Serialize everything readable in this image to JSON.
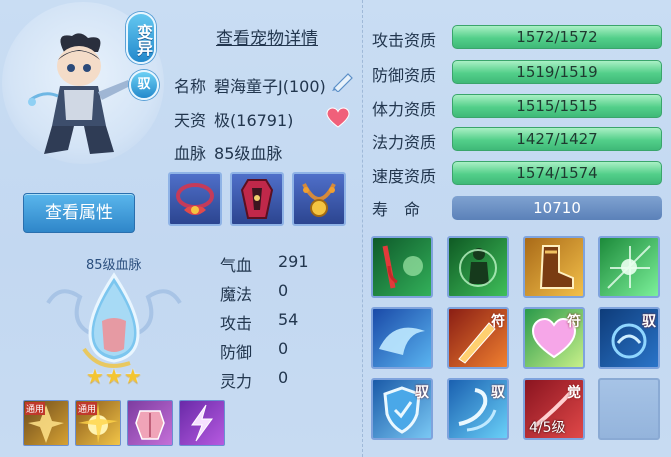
{
  "pet": {
    "transform_badge": "变异",
    "tame_badge": "驭",
    "details_link": "查看宠物详情",
    "name_label": "名称",
    "name_value": "碧海童子J(100)",
    "talent_label": "天资",
    "talent_value": "极(16791)",
    "bloodline_label": "血脉",
    "bloodline_value": "85级血脉",
    "view_attributes_button": "查看属性"
  },
  "bloodline_panel": {
    "title": "85级血脉",
    "stars": 3
  },
  "stats": [
    {
      "label": "气血",
      "value": "291"
    },
    {
      "label": "魔法",
      "value": "0"
    },
    {
      "label": "攻击",
      "value": "54"
    },
    {
      "label": "防御",
      "value": "0"
    },
    {
      "label": "灵力",
      "value": "0"
    }
  ],
  "aptitudes": [
    {
      "label": "攻击资质",
      "value": "1572/1572",
      "fill": 1.0
    },
    {
      "label": "防御资质",
      "value": "1519/1519",
      "fill": 1.0
    },
    {
      "label": "体力资质",
      "value": "1515/1515",
      "fill": 1.0
    },
    {
      "label": "法力资质",
      "value": "1427/1427",
      "fill": 1.0
    },
    {
      "label": "速度资质",
      "value": "1574/1574",
      "fill": 1.0
    }
  ],
  "life": {
    "label": "寿　命",
    "value": "10710"
  },
  "skills": {
    "tags": {
      "fu": "符",
      "yu": "驭",
      "jue": "觉"
    },
    "awakened_level": "4/5级"
  },
  "small_skills": {
    "tag": "通用"
  },
  "colors": {
    "accent_blue": "#2f86c9",
    "aptitude_green": "#53cf8a",
    "life_bar": "#5b81b9",
    "star_gold": "#f3c531"
  }
}
